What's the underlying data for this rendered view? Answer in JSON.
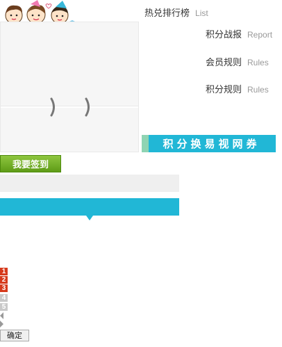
{
  "nav": {
    "items": [
      {
        "cn": "热兑排行榜",
        "en": "List"
      },
      {
        "cn": "积分战报",
        "en": "Report"
      },
      {
        "cn": "会员规则",
        "en": "Rules"
      },
      {
        "cn": "积分规则",
        "en": "Rules"
      }
    ]
  },
  "banner": {
    "text": "积分换易视网券"
  },
  "sign_button": {
    "label": "我要签到"
  },
  "ranks": [
    {
      "label": "1",
      "color": "#d63a1c"
    },
    {
      "label": "2",
      "color": "#d63a1c"
    },
    {
      "label": "3",
      "color": "#d63a1c"
    },
    {
      "label": "4",
      "color": "#c9c9c9"
    },
    {
      "label": "5",
      "color": "#c9c9c9"
    }
  ],
  "confirm_button": {
    "label": "确定"
  },
  "colors": {
    "accent": "#21b7d6",
    "green": "#6aa821",
    "rank_hot": "#d63a1c"
  }
}
